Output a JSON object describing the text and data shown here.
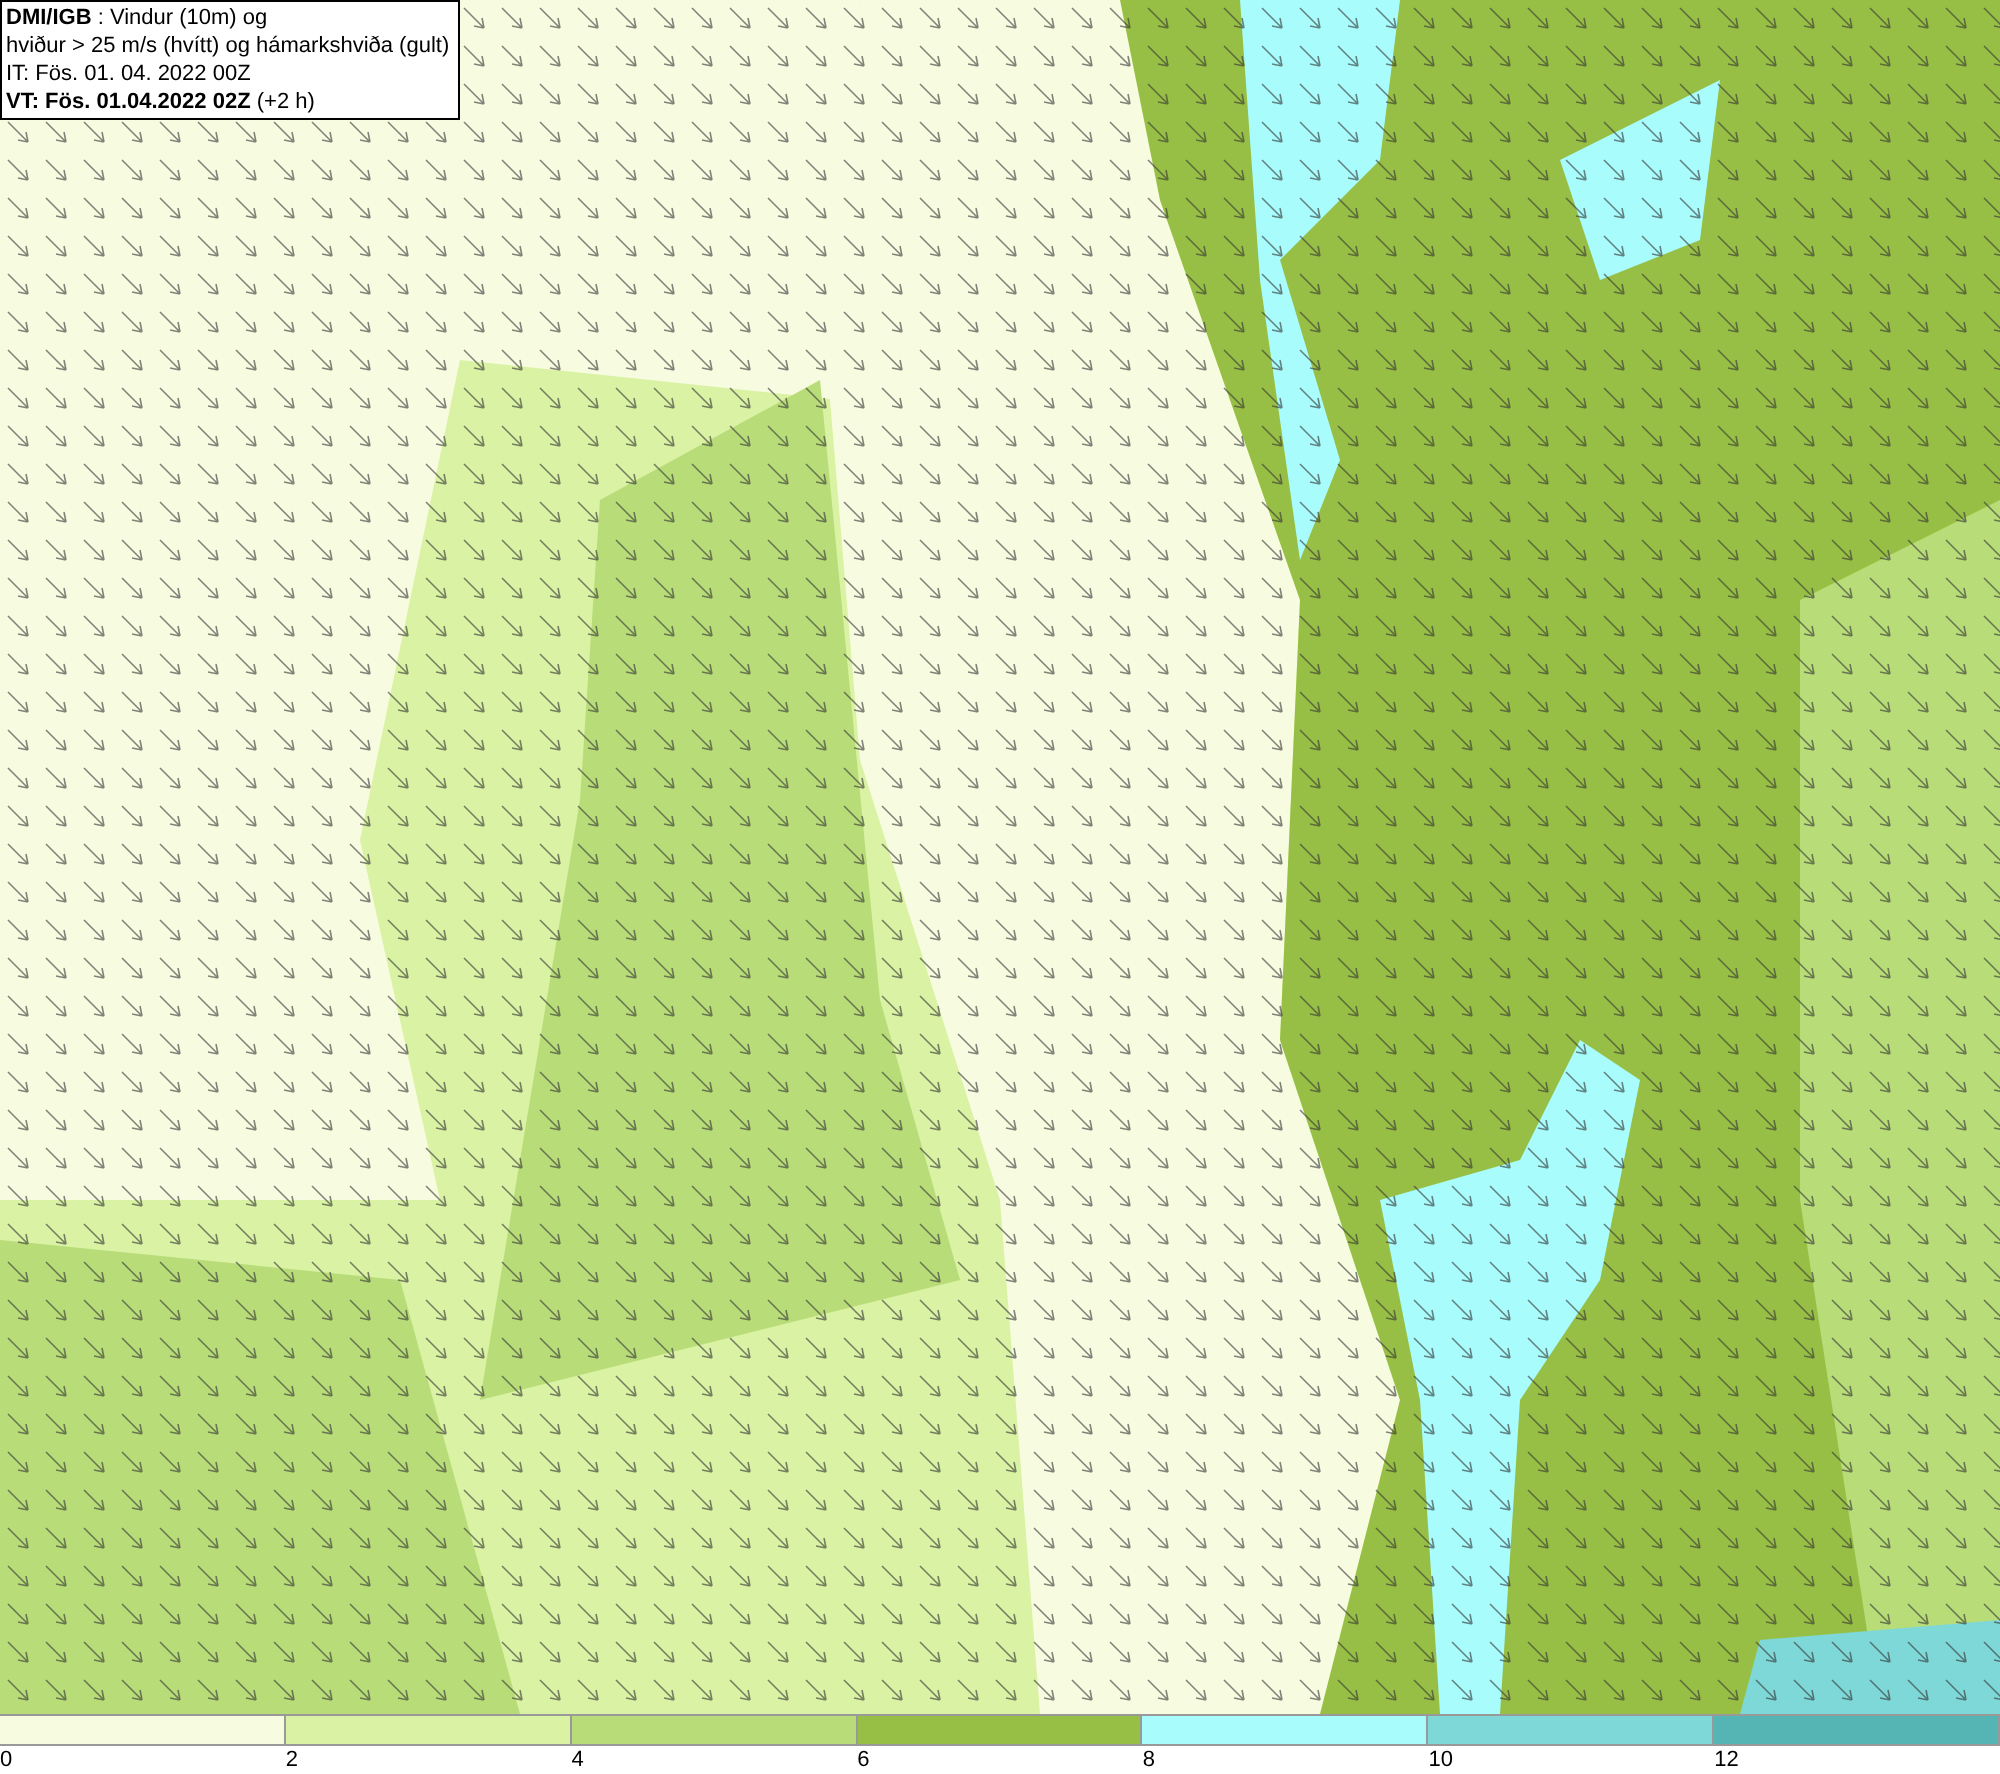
{
  "title_box": {
    "lines": [
      "**DMI/IGB** : Vindur (10m) og",
      "hviður > 25 m/s (hvítt) og hámarkshviða (gult)",
      "IT: Fös. 01. 04. 2022 00Z",
      "**VT: Fös. 01.04.2022 02Z** (+2 h)"
    ]
  },
  "legend": {
    "segments": [
      {
        "color": "#f7fce0"
      },
      {
        "color": "#d9f2a3"
      },
      {
        "color": "#b8dc78"
      },
      {
        "color": "#98bf45"
      },
      {
        "color": "#a8fcfc"
      },
      {
        "color": "#7ed8d8"
      },
      {
        "color": "#55b5b5"
      }
    ],
    "ticks": [
      "0",
      "2",
      "4",
      "6",
      "8",
      "10",
      "12"
    ]
  }
}
